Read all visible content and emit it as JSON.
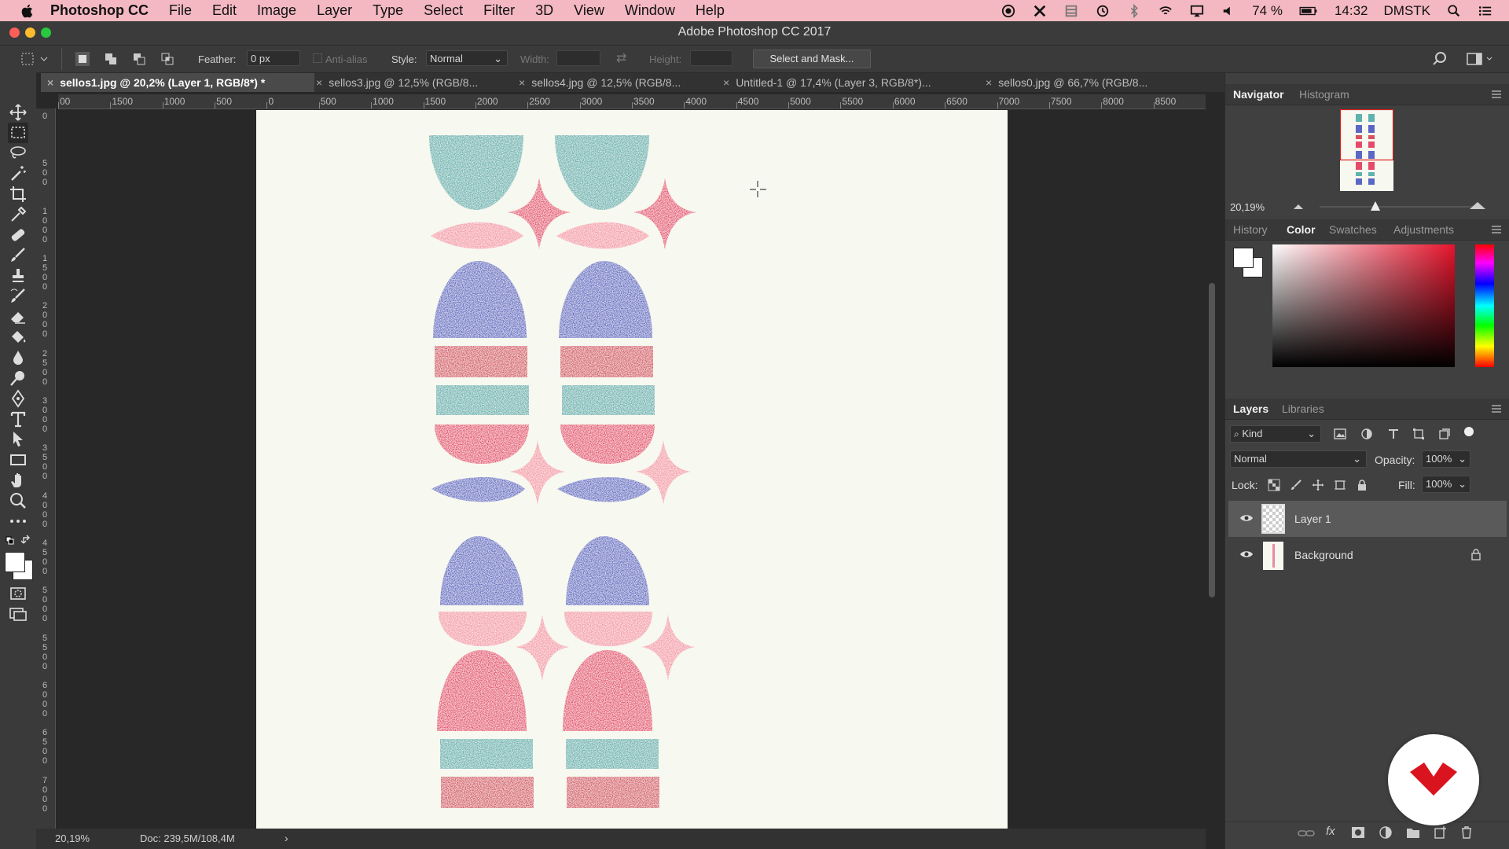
{
  "menubar": {
    "app_name": "Photoshop CC",
    "items": [
      "File",
      "Edit",
      "Image",
      "Layer",
      "Type",
      "Select",
      "Filter",
      "3D",
      "View",
      "Window",
      "Help"
    ],
    "battery": "74 %",
    "time": "14:32",
    "user": "DMSTK"
  },
  "window": {
    "title": "Adobe Photoshop CC 2017"
  },
  "options": {
    "feather_label": "Feather:",
    "feather_value": "0 px",
    "antialias_label": "Anti-alias",
    "style_label": "Style:",
    "style_value": "Normal",
    "width_label": "Width:",
    "height_label": "Height:",
    "select_mask_label": "Select and Mask..."
  },
  "tabs": [
    {
      "label": "sellos1.jpg @ 20,2% (Layer 1, RGB/8*) *"
    },
    {
      "label": "sellos3.jpg @ 12,5% (RGB/8..."
    },
    {
      "label": "sellos4.jpg @ 12,5% (RGB/8..."
    },
    {
      "label": "Untitled-1 @ 17,4% (Layer 3, RGB/8*)..."
    },
    {
      "label": "sellos0.jpg @ 66,7% (RGB/8..."
    }
  ],
  "ruler": {
    "h_ticks": [
      "00",
      "1500",
      "1000",
      "500",
      "0",
      "500",
      "1000",
      "1500",
      "2000",
      "2500",
      "3000",
      "3500",
      "4000",
      "4500",
      "5000",
      "5500",
      "6000",
      "6500",
      "7000",
      "7500",
      "8000",
      "8500"
    ],
    "v_ticks": [
      "0",
      "5 0 0",
      "1 0 0 0",
      "1 5 0 0",
      "2 0 0 0",
      "2 5 0 0",
      "3 0 0 0",
      "3 5 0 0",
      "4 0 0 0",
      "4 5 0 0",
      "5 0 0 0",
      "5 5 0 0",
      "6 0 0 0",
      "6 5 0 0",
      "7 0 0 0"
    ]
  },
  "status": {
    "zoom": "20,19%",
    "doc": "Doc: 239,5M/108,4M"
  },
  "navigator": {
    "tab_active": "Navigator",
    "tab_other": "Histogram",
    "zoom": "20,19%"
  },
  "color_panel": {
    "tabs": [
      "History",
      "Color",
      "Swatches",
      "Adjustments"
    ],
    "active": "Color"
  },
  "layers_panel": {
    "tab_active": "Layers",
    "tab_other": "Libraries",
    "filter_kind": "Kind",
    "blend_mode": "Normal",
    "opacity_label": "Opacity:",
    "opacity_value": "100%",
    "lock_label": "Lock:",
    "fill_label": "Fill:",
    "fill_value": "100%",
    "layers": [
      {
        "name": "Layer 1",
        "selected": true
      },
      {
        "name": "Background",
        "locked": true
      }
    ]
  },
  "colors": {
    "menubar": "#f3b8c1",
    "teal": "#5fb2ae",
    "red": "#e64a6a",
    "pink": "#f49aa6",
    "blue": "#5b67c4",
    "brick": "#d6525e"
  }
}
